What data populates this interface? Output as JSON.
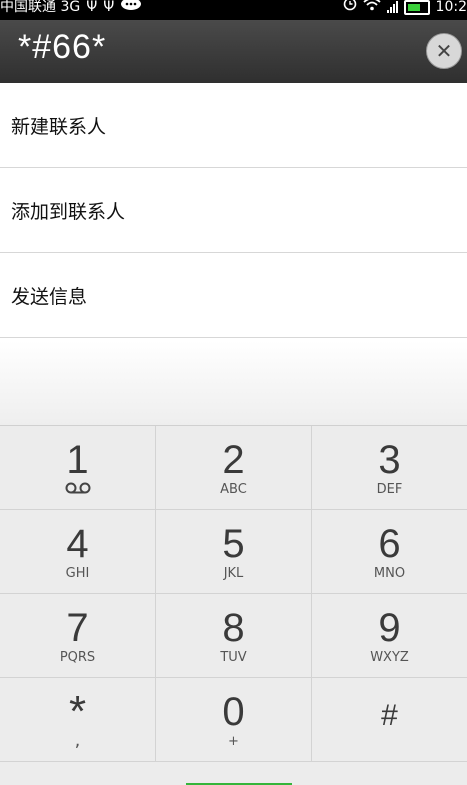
{
  "status_bar": {
    "carrier": "中国联通 3G",
    "time": "10:2",
    "icons": [
      "usb-icon",
      "usb-icon",
      "chat-icon",
      "alarm-icon",
      "wifi-icon",
      "signal-icon",
      "battery-icon"
    ]
  },
  "dialer": {
    "number": "*#66*",
    "clear_label": "✕"
  },
  "options": [
    {
      "label": "新建联系人"
    },
    {
      "label": "添加到联系人"
    },
    {
      "label": "发送信息"
    }
  ],
  "keys": [
    {
      "digit": "1",
      "letters": ""
    },
    {
      "digit": "2",
      "letters": "ABC"
    },
    {
      "digit": "3",
      "letters": "DEF"
    },
    {
      "digit": "4",
      "letters": "GHI"
    },
    {
      "digit": "5",
      "letters": "JKL"
    },
    {
      "digit": "6",
      "letters": "MNO"
    },
    {
      "digit": "7",
      "letters": "PQRS"
    },
    {
      "digit": "8",
      "letters": "TUV"
    },
    {
      "digit": "9",
      "letters": "WXYZ"
    },
    {
      "digit": "*",
      "letters": ","
    },
    {
      "digit": "0",
      "letters": "+"
    },
    {
      "digit": "#",
      "letters": ""
    }
  ],
  "colors": {
    "header_bg": "#3a3a3a",
    "battery": "#3bd13b",
    "call_strip": "#34b53a"
  }
}
